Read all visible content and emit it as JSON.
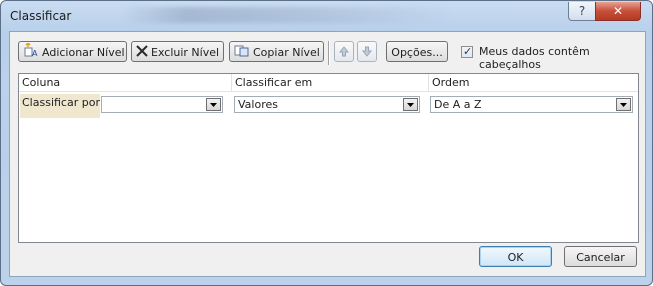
{
  "window": {
    "title": "Classificar"
  },
  "toolbar": {
    "add_level_label": "Adicionar Nível",
    "delete_level_label": "Excluir Nível",
    "copy_level_label": "Copiar Nível",
    "options_label": "Opções...",
    "headers_checkbox_label": "Meus dados contêm cabeçalhos",
    "headers_checked": true
  },
  "grid": {
    "headers": {
      "column": "Coluna",
      "sort_on": "Classificar em",
      "order": "Ordem"
    },
    "row": {
      "label": "Classificar por",
      "column_value": "",
      "sort_on_value": "Valores",
      "order_value": "De A a Z"
    }
  },
  "footer": {
    "ok_label": "OK",
    "cancel_label": "Cancelar"
  },
  "colors": {
    "title_bg": "#c9dcf1",
    "close_red": "#c7503a",
    "row_label_bg": "#efe8cf"
  }
}
